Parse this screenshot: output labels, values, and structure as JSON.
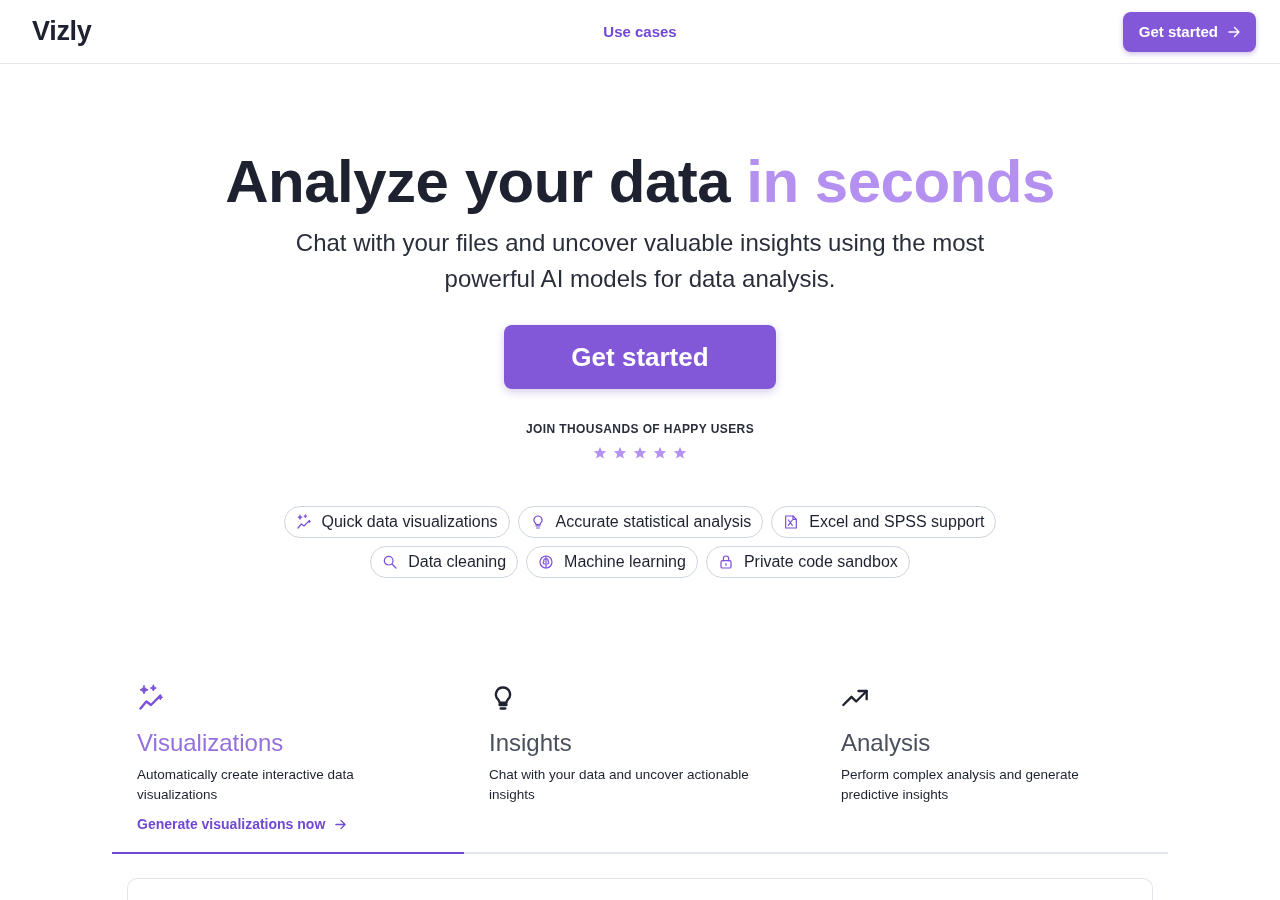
{
  "header": {
    "logo": "Vizly",
    "nav": [
      {
        "label": "Use cases"
      }
    ],
    "cta": "Get started"
  },
  "hero": {
    "title": "Analyze your data",
    "title_highlight": "in seconds",
    "subtitle": "Chat with your files and uncover valuable insights using the most powerful AI models for data analysis.",
    "cta": "Get started",
    "social_proof": "JOIN THOUSANDS OF HAPPY USERS",
    "stars": 5
  },
  "capabilities": [
    {
      "label": "Quick data visualizations"
    },
    {
      "label": "Accurate statistical analysis"
    },
    {
      "label": "Excel and SPSS support"
    },
    {
      "label": "Data cleaning"
    },
    {
      "label": "Machine learning"
    },
    {
      "label": "Private code sandbox"
    }
  ],
  "feature_tabs": [
    {
      "title": "Visualizations",
      "description": "Automatically create interactive data visualizations",
      "link": "Generate visualizations now",
      "selected": true
    },
    {
      "title": "Insights",
      "description": "Chat with your data and uncover actionable insights",
      "selected": false
    },
    {
      "title": "Analysis",
      "description": "Perform complex analysis and generate predictive insights",
      "selected": false
    }
  ]
}
